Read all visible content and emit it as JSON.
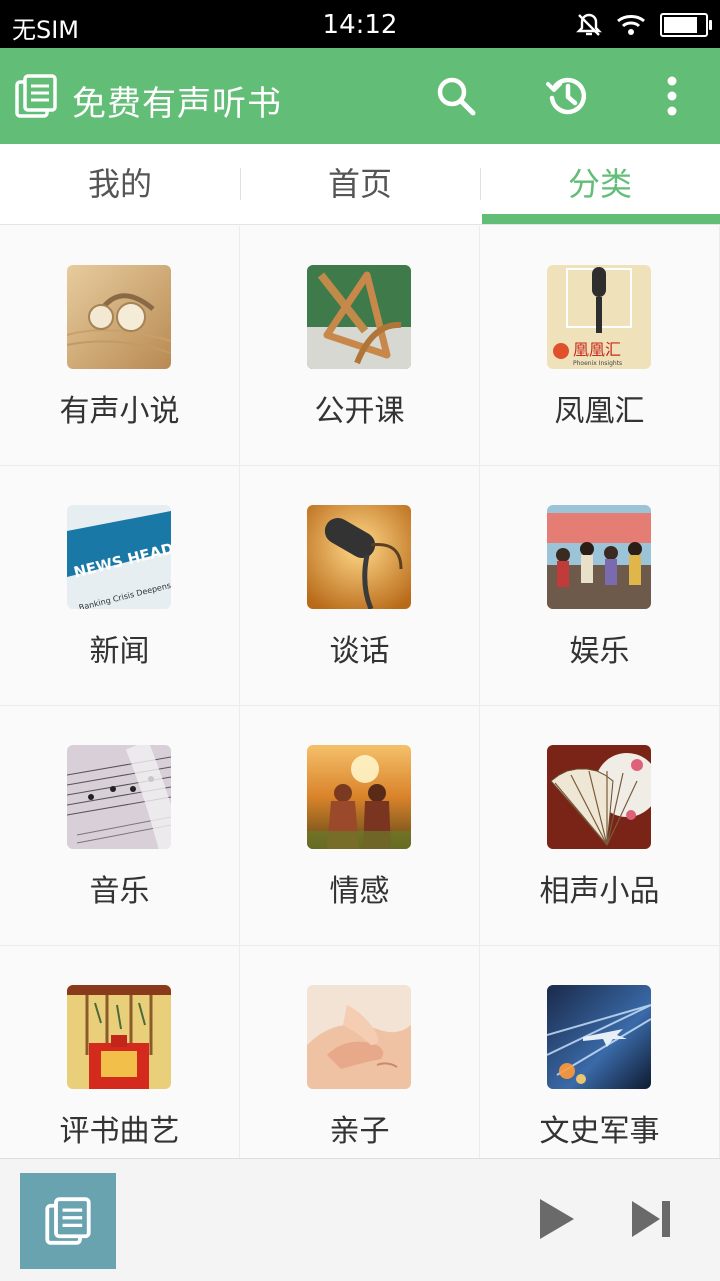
{
  "status_bar": {
    "carrier": "无SIM",
    "time": "14:12",
    "battery_level": 0.85
  },
  "app_bar": {
    "title": "免费有声听书",
    "icons": [
      "book-icon",
      "search-icon",
      "history-icon",
      "more-vert-icon"
    ]
  },
  "tabs": [
    {
      "label": "我的",
      "active": false
    },
    {
      "label": "首页",
      "active": false
    },
    {
      "label": "分类",
      "active": true
    }
  ],
  "categories": [
    {
      "label": "有声小说",
      "icon": "headphones-thumbnail"
    },
    {
      "label": "公开课",
      "icon": "ruler-thumbnail"
    },
    {
      "label": "凤凰汇",
      "icon": "microphone-thumbnail",
      "logo_text": "凰凰汇",
      "logo_subtext": "Phoenix Insights"
    },
    {
      "label": "新闻",
      "icon": "news-thumbnail",
      "logo_text": "NEWS HEADLINES",
      "logo_subtext": "Banking Crisis Deepens"
    },
    {
      "label": "谈话",
      "icon": "vintage-mic-thumbnail"
    },
    {
      "label": "娱乐",
      "icon": "crowd-thumbnail"
    },
    {
      "label": "音乐",
      "icon": "sheet-music-thumbnail"
    },
    {
      "label": "情感",
      "icon": "couple-sunset-thumbnail"
    },
    {
      "label": "相声小品",
      "icon": "folding-fan-thumbnail"
    },
    {
      "label": "评书曲艺",
      "icon": "stage-thumbnail"
    },
    {
      "label": "亲子",
      "icon": "hands-thumbnail"
    },
    {
      "label": "文史军事",
      "icon": "jet-thumbnail"
    }
  ],
  "player": {
    "icons": [
      "book-cover-icon",
      "play-icon",
      "skip-next-icon"
    ]
  },
  "colors": {
    "accent": "#62bd76",
    "status_bar": "#000000",
    "player_cover": "#6aa3b0"
  }
}
